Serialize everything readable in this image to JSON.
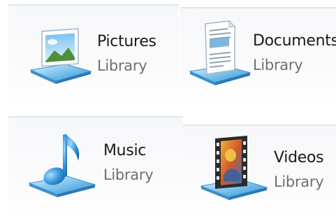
{
  "libraries": [
    {
      "title": "Pictures",
      "subtitle": "Library",
      "icon": "pictures-library-icon"
    },
    {
      "title": "Documents",
      "subtitle": "Library",
      "icon": "documents-library-icon"
    },
    {
      "title": "Music",
      "subtitle": "Library",
      "icon": "music-library-icon"
    },
    {
      "title": "Videos",
      "subtitle": "Library",
      "icon": "videos-library-icon"
    }
  ],
  "colors": {
    "platform_blue": "#4aa3de",
    "platform_light": "#bfe3f7",
    "title_text": "#1b1b1b",
    "subtitle_text": "#6f6f6f"
  }
}
